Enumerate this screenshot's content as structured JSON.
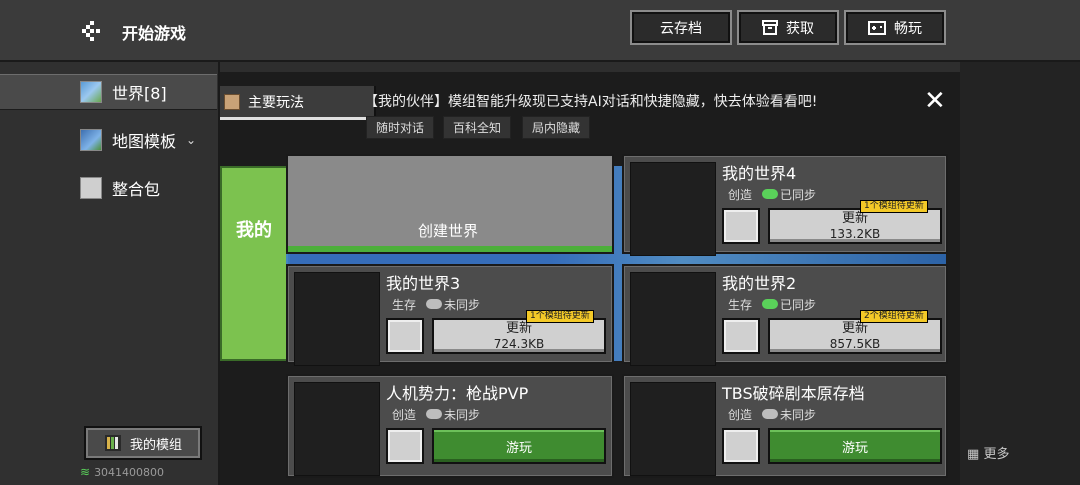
{
  "header": {
    "title": "开始游戏",
    "buttons": [
      {
        "label": "云存档"
      },
      {
        "label": "获取"
      },
      {
        "label": "畅玩"
      }
    ]
  },
  "sidebar": {
    "items": [
      {
        "label": "世界[8]",
        "active": true
      },
      {
        "label": "地图模板"
      },
      {
        "label": "整合包"
      }
    ],
    "mymods_label": "我的模组",
    "network_id": "3041400800"
  },
  "main": {
    "tab_label": "主要玩法",
    "announcement": "【我的伙伴】模组智能升级现已支持AI对话和快捷隐藏，快去体验看看吧!",
    "chips": [
      "随时对话",
      "百科全知",
      "局内隐藏"
    ],
    "background_text": "我的",
    "more_label": "更多",
    "create_world_label": "创建世界"
  },
  "worlds": [
    {
      "title": "我的世界4",
      "mode": "创造",
      "sync": "已同步",
      "button": "更新",
      "size": "133.2KB",
      "badge": "1个模组待更新"
    },
    {
      "title": "我的世界3",
      "mode": "生存",
      "sync": "未同步",
      "button": "更新",
      "size": "724.3KB",
      "badge": "1个模组待更新"
    },
    {
      "title": "我的世界2",
      "mode": "生存",
      "sync": "已同步",
      "button": "更新",
      "size": "857.5KB",
      "badge": "2个模组待更新"
    },
    {
      "title": "人机势力：枪战PVP",
      "mode": "创造",
      "sync": "未同步",
      "button": "游玩"
    },
    {
      "title": "TBS破碎剧本原存档",
      "mode": "创造",
      "sync": "未同步",
      "button": "游玩"
    }
  ],
  "colors": {
    "accent_green": "#3f8c30",
    "badge_yellow": "#f3c927",
    "synced_cloud": "#5ad15a",
    "unsynced_cloud": "#bdbdbd"
  }
}
